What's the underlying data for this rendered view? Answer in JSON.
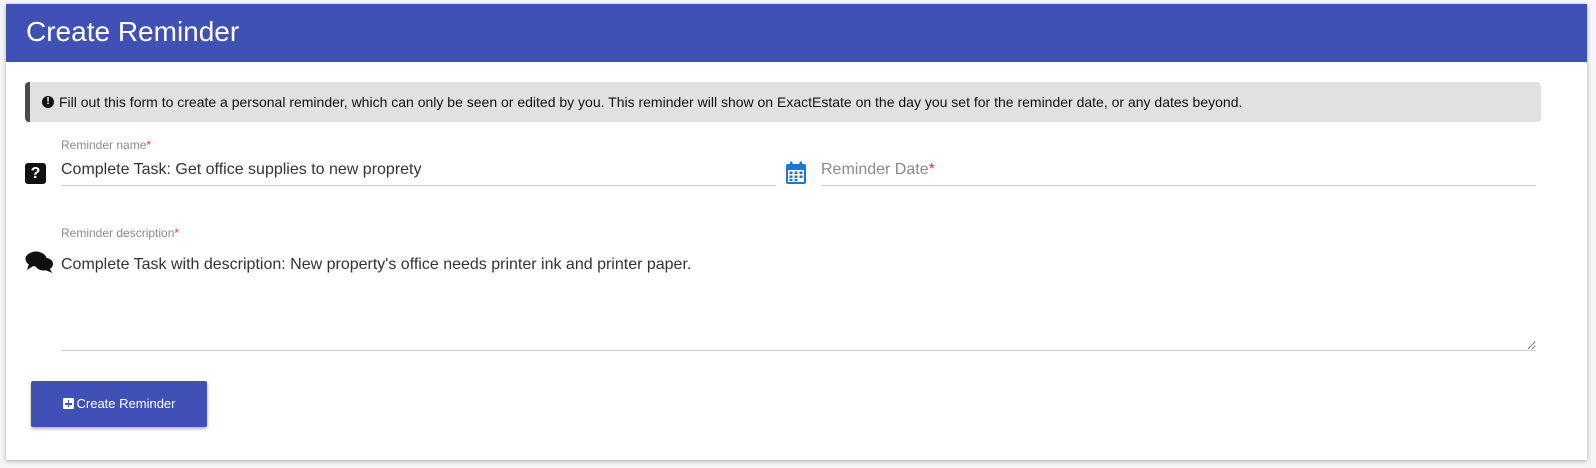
{
  "header": {
    "title": "Create Reminder"
  },
  "alert": {
    "icon": "exclamation-circle-icon",
    "text": "Fill out this form to create a personal reminder, which can only be seen or edited by you. This reminder will show on ExactEstate on the day you set for the reminder date, or any dates beyond."
  },
  "form": {
    "name": {
      "icon": "question-square-icon",
      "label": "Reminder name",
      "required_mark": "*",
      "value": "Complete Task: Get office supplies to new proprety"
    },
    "date": {
      "icon": "calendar-icon",
      "placeholder": "Reminder Date",
      "required_mark": "*",
      "value": ""
    },
    "description": {
      "icon": "comments-icon",
      "label": "Reminder description",
      "required_mark": "*",
      "value": "Complete Task with description: New property's office needs printer ink and printer paper."
    }
  },
  "submit": {
    "icon": "plus-square-icon",
    "label": "Create Reminder"
  },
  "colors": {
    "primary": "#3f51b5",
    "required": "#e53935",
    "calendar": "#1976d2"
  }
}
